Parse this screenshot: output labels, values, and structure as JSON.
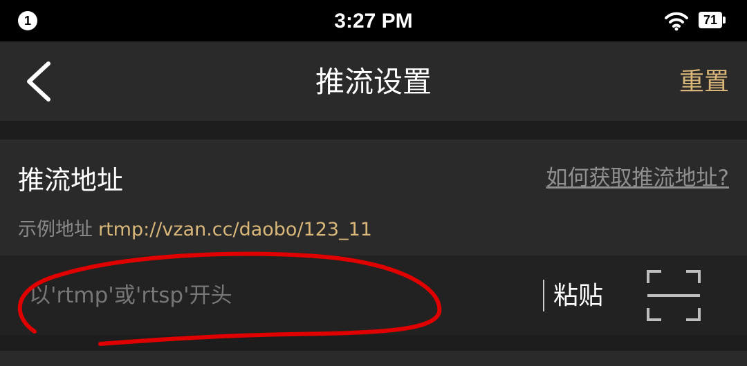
{
  "status_bar": {
    "notification_count": "1",
    "time": "3:27 PM",
    "battery_level": "71",
    "icons": [
      "wifi-icon",
      "battery-icon"
    ]
  },
  "nav": {
    "back_icon": "chevron-left-icon",
    "title": "推流设置",
    "reset_label": "重置"
  },
  "stream_section": {
    "title": "推流地址",
    "help_link": "如何获取推流地址?",
    "example_label": "示例地址",
    "example_url": "rtmp://vzan.cc/daobo/123_11"
  },
  "input_row": {
    "placeholder": "以'rtmp'或'rtsp'开头",
    "value": "",
    "paste_label": "粘贴",
    "scan_icon": "scan-icon"
  },
  "colors": {
    "accent": "#d9b77a",
    "background": "#1d1d1d",
    "panel": "#2a2a2a",
    "annotation": "#e00000"
  }
}
